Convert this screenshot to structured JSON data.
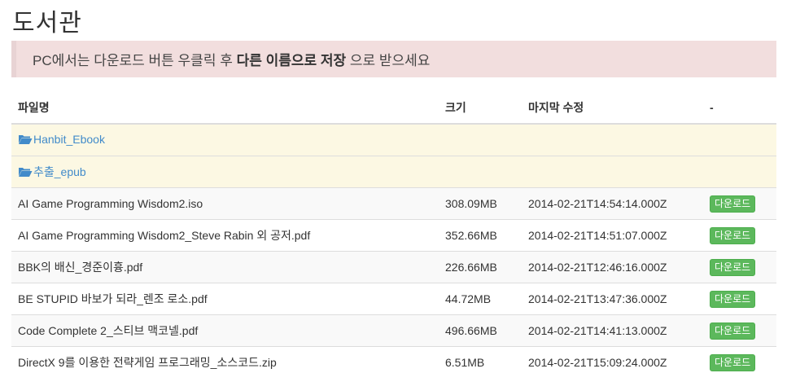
{
  "page_title": "도서관",
  "alert": {
    "part1": "PC에서는 다운로드 버튼 우클릭 후 ",
    "bold": "다른 이름으로 저장",
    "part2": " 으로 받으세요"
  },
  "table": {
    "headers": {
      "name": "파일명",
      "size": "크기",
      "modified": "마지막 수정",
      "action": "-"
    },
    "folders": [
      {
        "name": "Hanbit_Ebook"
      },
      {
        "name": "추출_epub"
      }
    ],
    "files": [
      {
        "name": "AI Game Programming Wisdom2.iso",
        "size": "308.09MB",
        "modified": "2014-02-21T14:54:14.000Z",
        "button": "다운로드"
      },
      {
        "name": "AI Game Programming Wisdom2_Steve Rabin 외 공저.pdf",
        "size": "352.66MB",
        "modified": "2014-02-21T14:51:07.000Z",
        "button": "다운로드"
      },
      {
        "name": "BBK의 배신_경준이흉.pdf",
        "size": "226.66MB",
        "modified": "2014-02-21T12:46:16.000Z",
        "button": "다운로드"
      },
      {
        "name": "BE STUPID 바보가 되라_렌조 로소.pdf",
        "size": "44.72MB",
        "modified": "2014-02-21T13:47:36.000Z",
        "button": "다운로드"
      },
      {
        "name": "Code Complete 2_스티브 맥코넬.pdf",
        "size": "496.66MB",
        "modified": "2014-02-21T14:41:13.000Z",
        "button": "다운로드"
      },
      {
        "name": "DirectX 9를 이용한 전략게임 프로그래밍_소스코드.zip",
        "size": "6.51MB",
        "modified": "2014-02-21T15:09:24.000Z",
        "button": "다운로드"
      }
    ]
  },
  "colors": {
    "alert_bg": "#f2dede",
    "folder_row_bg": "#fcf8e3",
    "link": "#428bca",
    "button_success": "#5cb85c"
  },
  "icons": {
    "folder": "folder-open-icon"
  }
}
